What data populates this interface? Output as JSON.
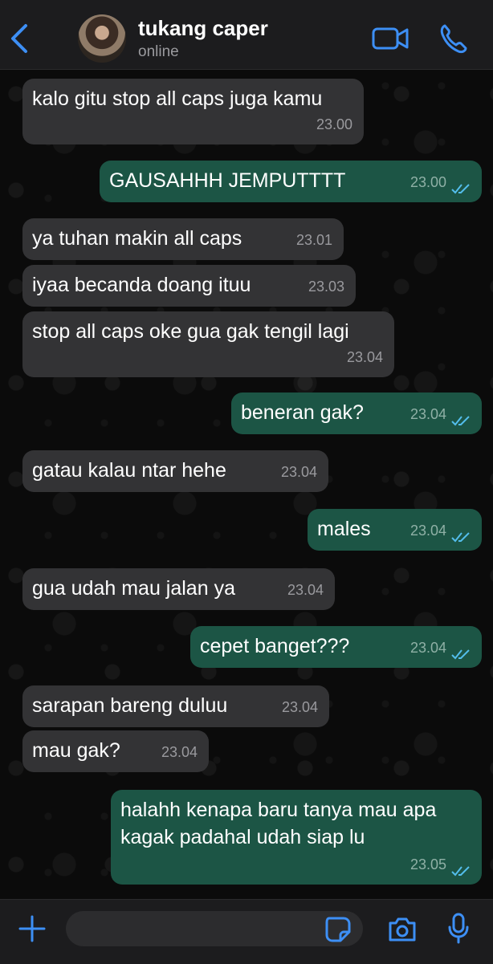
{
  "header": {
    "contact_name": "tukang caper",
    "status": "online",
    "back_icon": "chevron-left-icon",
    "video_icon": "video-camera-icon",
    "call_icon": "phone-icon",
    "accent_color": "#3d8ff5"
  },
  "messages": [
    {
      "dir": "in",
      "text": "kalo gitu stop all caps juga kamu",
      "time": "23.00"
    },
    {
      "dir": "out",
      "text": "GAUSAHHH JEMPUTTTT",
      "time": "23.00",
      "read": true
    },
    {
      "dir": "in",
      "text": "ya tuhan makin all caps",
      "time": "23.01"
    },
    {
      "dir": "in",
      "text": "iyaa becanda doang ituu",
      "time": "23.03"
    },
    {
      "dir": "in",
      "text": "stop all caps oke gua gak tengil lagi",
      "time": "23.04"
    },
    {
      "dir": "out",
      "text": "beneran gak?",
      "time": "23.04",
      "read": true
    },
    {
      "dir": "in",
      "text": "gatau kalau ntar hehe",
      "time": "23.04"
    },
    {
      "dir": "out",
      "text": "males",
      "time": "23.04",
      "read": true
    },
    {
      "dir": "in",
      "text": "gua udah mau jalan ya",
      "time": "23.04"
    },
    {
      "dir": "out",
      "text": "cepet banget???",
      "time": "23.04",
      "read": true
    },
    {
      "dir": "in",
      "text": "sarapan bareng duluu",
      "time": "23.04"
    },
    {
      "dir": "in",
      "text": "mau gak?",
      "time": "23.04"
    },
    {
      "dir": "out",
      "text_line1": "halahh kenapa baru tanya mau apa",
      "text_line2": "kagak padahal udah siap lu",
      "time": "23.05",
      "read": true
    }
  ],
  "composer": {
    "placeholder": "",
    "plus_icon": "plus-icon",
    "sticker_icon": "sticker-icon",
    "camera_icon": "camera-icon",
    "mic_icon": "microphone-icon"
  },
  "colors": {
    "incoming_bubble": "#333335",
    "outgoing_bubble": "#1c5545",
    "read_ticks": "#53bdeb"
  }
}
